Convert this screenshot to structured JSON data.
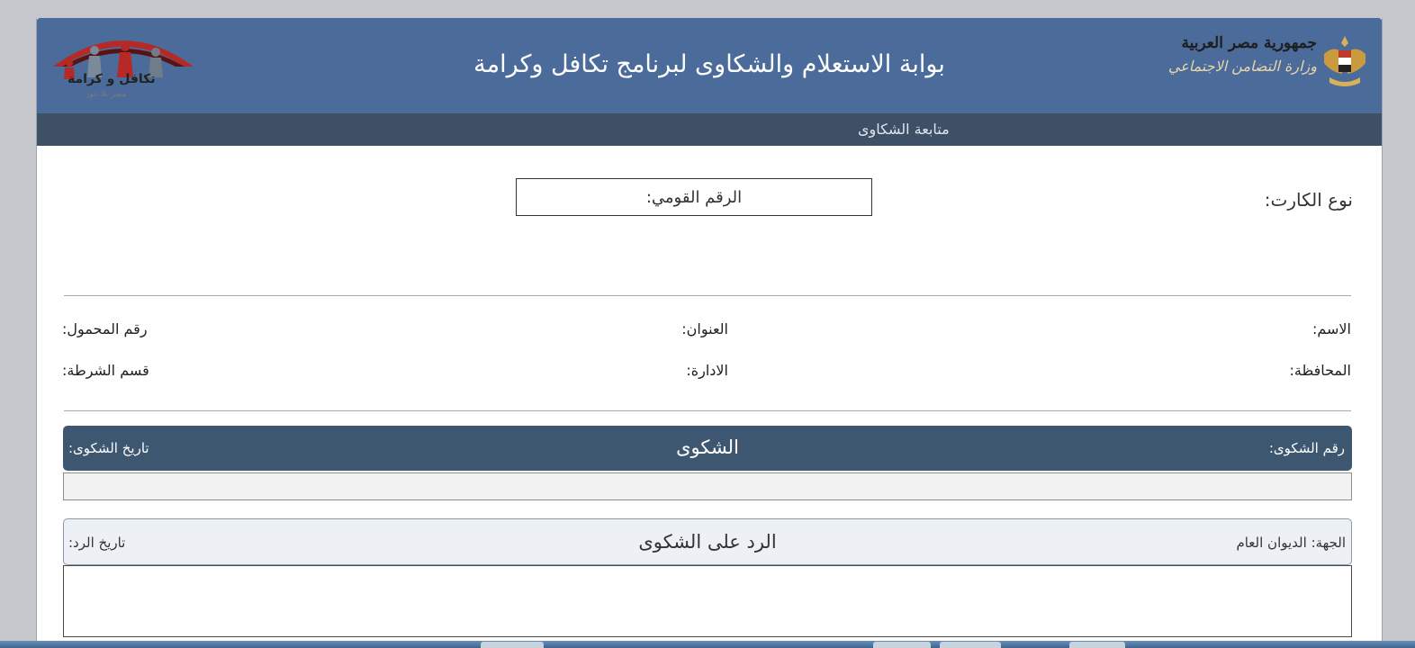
{
  "header": {
    "title": "بوابة الاستعلام والشكاوى لبرنامج تكافل وكرامة",
    "country": "جمهورية مصر العربية",
    "ministry": "وزارة التضامن الاجتماعي",
    "logo_text": "تكافل و كرامة",
    "logo_tagline": "مصر بلا عوز"
  },
  "nav": {
    "item_label": "متابعة الشكاوى"
  },
  "card_type": {
    "label": "نوع الكارت:"
  },
  "national_id": {
    "label": "الرقم القومي:"
  },
  "person": {
    "name_label": "الاسم:",
    "address_label": "العنوان:",
    "mobile_label": "رقم المحمول:",
    "governorate_label": "المحافظة:",
    "administration_label": "الادارة:",
    "police_station_label": "قسم الشرطة:"
  },
  "complaint": {
    "number_label": "رقم الشكوى:",
    "title": "الشكوى",
    "date_label": "تاريخ الشكوى:"
  },
  "reply": {
    "entity_label": "الجهة:",
    "entity_value": "الديوان العام",
    "title": "الرد على الشكوى",
    "date_label": "تاريخ الرد:"
  },
  "colors": {
    "header_bg": "#4b6b9b",
    "nav_bg": "#3d5066",
    "complaint_bar_bg": "#3e5770",
    "reply_bar_bg": "#edf1f6"
  }
}
